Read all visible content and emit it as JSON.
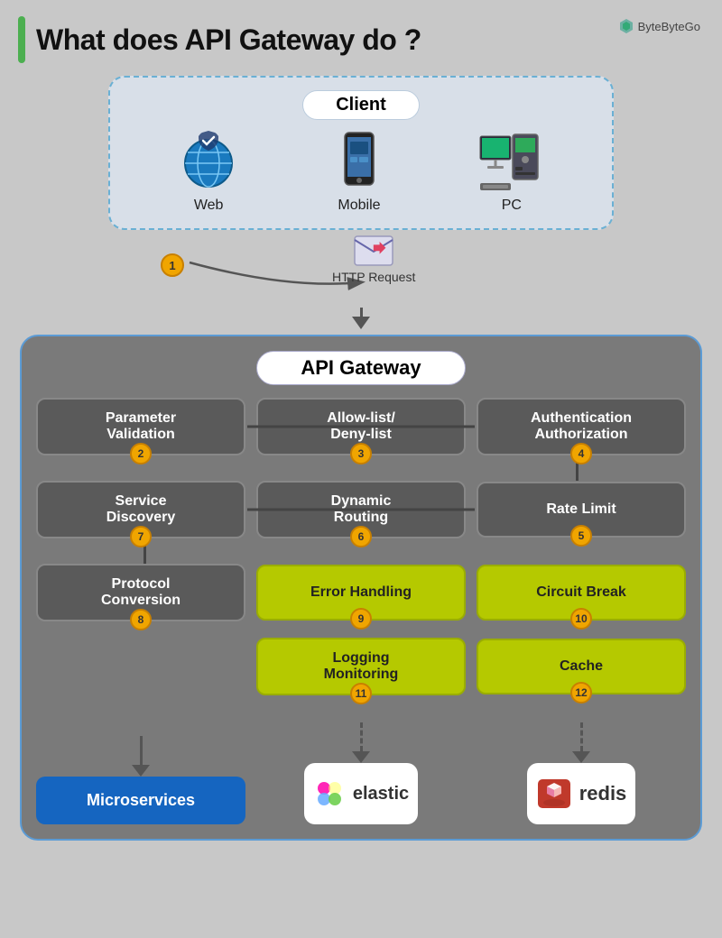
{
  "title": "What does API Gateway do ?",
  "brand": "ByteByteGo",
  "client": {
    "label": "Client",
    "items": [
      {
        "id": "web",
        "label": "Web"
      },
      {
        "id": "mobile",
        "label": "Mobile"
      },
      {
        "id": "pc",
        "label": "PC"
      }
    ]
  },
  "http_request": "HTTP Request",
  "gateway_label": "API Gateway",
  "badges": [
    "1",
    "2",
    "3",
    "4",
    "5",
    "6",
    "7",
    "8",
    "9",
    "10",
    "11",
    "12"
  ],
  "boxes": {
    "row1": [
      {
        "label": "Parameter\nValidation",
        "type": "gray",
        "badge": "2"
      },
      {
        "label": "Allow-list/\nDeny-list",
        "type": "gray",
        "badge": "3"
      },
      {
        "label": "Authentication\nAuthorization",
        "type": "gray",
        "badge": "4"
      }
    ],
    "row2": [
      {
        "label": "Service\nDiscovery",
        "type": "gray",
        "badge": "7"
      },
      {
        "label": "Dynamic\nRouting",
        "type": "gray",
        "badge": "6"
      },
      {
        "label": "Rate Limit",
        "type": "gray",
        "badge": "5"
      }
    ],
    "row3": [
      {
        "label": "Protocol\nConversion",
        "type": "gray",
        "badge": "8"
      },
      {
        "label": "Error Handling",
        "type": "green",
        "badge": "9"
      },
      {
        "label": "Circuit Break",
        "type": "green",
        "badge": "10"
      }
    ],
    "row4": [
      {
        "label": "",
        "type": "none",
        "badge": ""
      },
      {
        "label": "Logging\nMonitoring",
        "type": "green",
        "badge": "11"
      },
      {
        "label": "Cache",
        "type": "green",
        "badge": "12"
      }
    ]
  },
  "bottom": {
    "microservices": "Microservices",
    "elastic": "elastic",
    "redis": "redis"
  }
}
